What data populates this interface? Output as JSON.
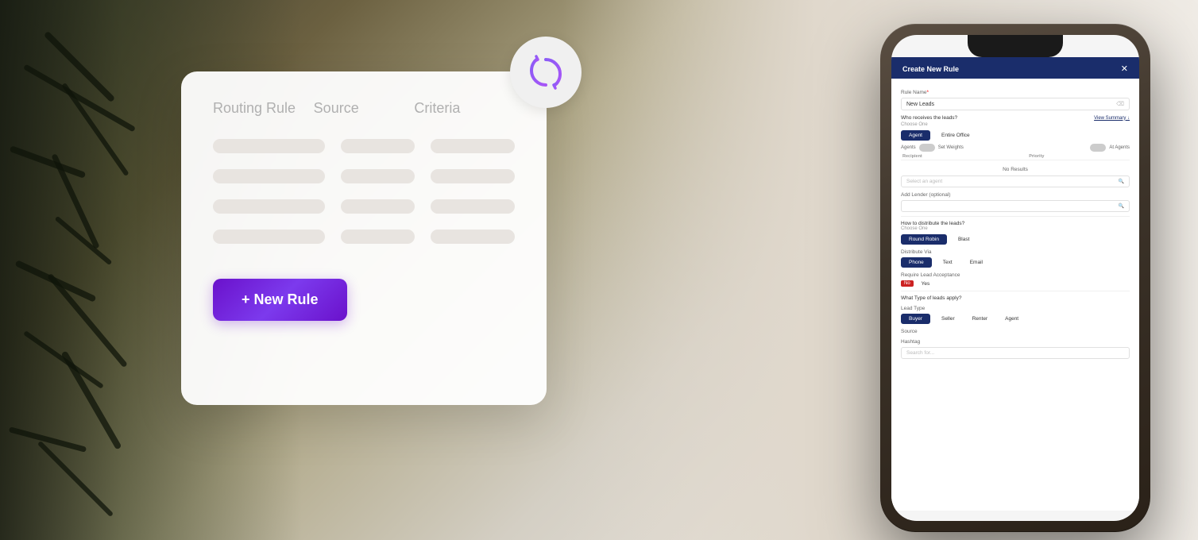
{
  "background": {
    "colors": {
      "left_dark": "#2a2a1a",
      "mid": "#9a9070",
      "right_light": "#f0ece6"
    }
  },
  "floating_card": {
    "columns": {
      "col1": "Routing Rule",
      "col2": "Source",
      "col3": "Criteria"
    },
    "skeleton_rows": [
      {
        "id": 1
      },
      {
        "id": 2
      },
      {
        "id": 3
      },
      {
        "id": 4
      }
    ],
    "new_rule_button": "+ New Rule"
  },
  "phone": {
    "modal": {
      "title": "Create New Rule",
      "close_label": "✕",
      "rule_name_label": "Rule Name",
      "rule_name_required": "*",
      "rule_name_value": "New Leads",
      "who_receives_label": "Who receives the leads?",
      "choose_one": "Choose One",
      "view_summary": "View Summary ↓",
      "agent_button": "Agent",
      "entire_office_label": "Entire Office",
      "agents_label": "Agents",
      "set_weights_label": "Set Weights",
      "at_agents_label": "At Agents",
      "recipient_header": "Recipient",
      "priority_header": "Priority",
      "no_results": "No Results",
      "select_agent_placeholder": "Select an agent",
      "add_lender_label": "Add Lender (optional)",
      "how_distribute_label": "How to distribute the leads?",
      "choose_one_2": "Choose One",
      "round_robin_button": "Round Robin",
      "blast_label": "Blast",
      "distribute_via_label": "Distribute Via",
      "phone_button": "Phone",
      "text_label": "Text",
      "email_label": "Email",
      "require_acceptance_label": "Require Lead Acceptance",
      "no_tag": "No",
      "yes_label": "Yes",
      "lead_type_section": "What Type of leads apply?",
      "lead_type_label": "Lead Type",
      "buyer_button": "Buyer",
      "seller_label": "Seller",
      "renter_label": "Renter",
      "agent_label": "Agent",
      "source_label": "Source",
      "hashtag_label": "Hashtag",
      "search_for_label": "Search for..."
    }
  },
  "refresh_icon": {
    "color1": "#8b5cf6",
    "color2": "#a855f7"
  }
}
